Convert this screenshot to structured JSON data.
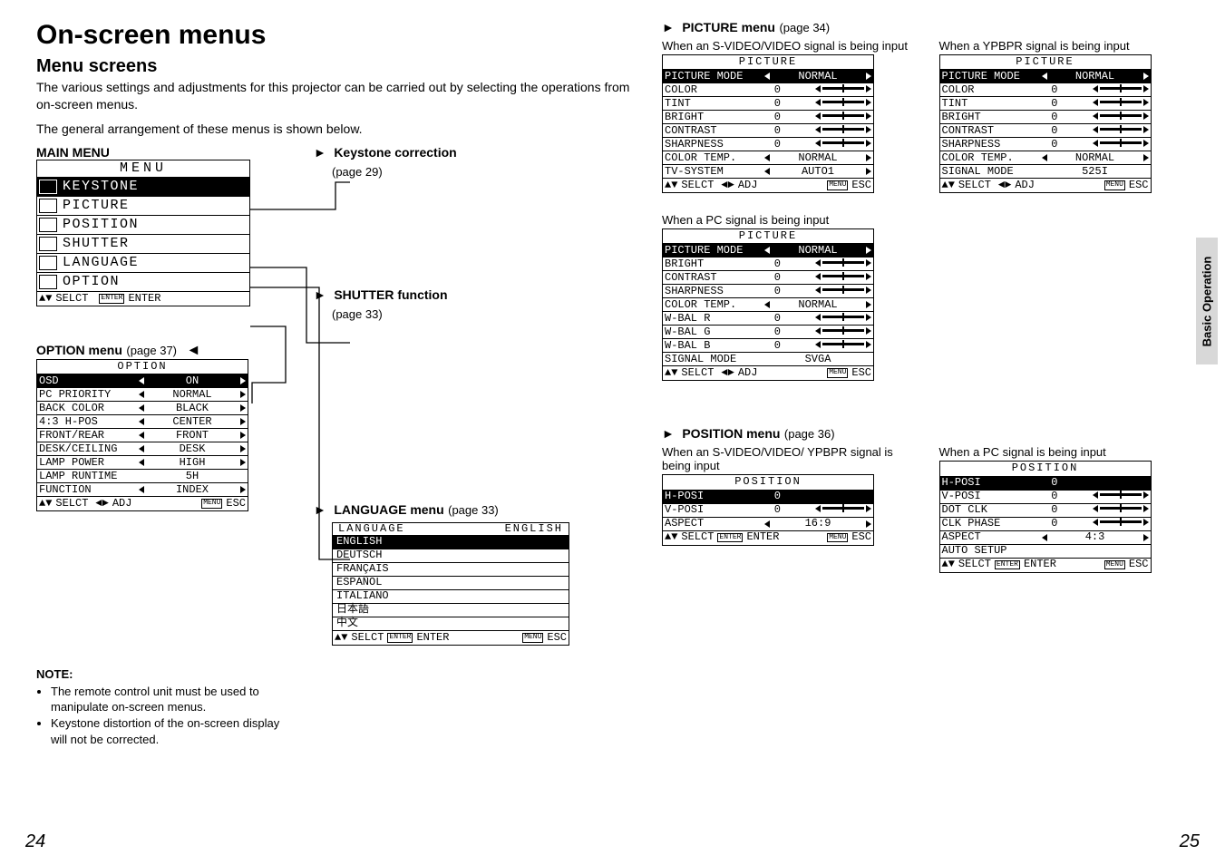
{
  "header": {
    "title": "On-screen menus",
    "subtitle": "Menu screens",
    "intro1": "The various settings and adjustments for this projector can be carried out by selecting the operations from on-screen menus.",
    "intro2": "The general arrangement of these menus is shown below."
  },
  "labels": {
    "main_menu": "MAIN MENU",
    "keystone": "Keystone correction",
    "keystone_ref": "(page 29)",
    "shutter": "SHUTTER function",
    "shutter_ref": "(page 33)",
    "option": "OPTION menu",
    "option_ref": "(page 37)",
    "language": "LANGUAGE menu",
    "language_ref": "(page 33)",
    "picture": "PICTURE menu",
    "picture_ref": "(page 34)",
    "picture_cap_sv": "When an S-VIDEO/VIDEO signal is being input",
    "picture_cap_yp": "When a YPBPR signal is being input",
    "picture_cap_pc": "When a PC signal is being input",
    "position": "POSITION menu",
    "position_ref": "(page 36)",
    "position_cap_sv": "When an S-VIDEO/VIDEO/ YPBPR signal is being input",
    "position_cap_pc": "When a PC signal is being input",
    "side_tab": "Basic Operation",
    "note_hdr": "NOTE:",
    "note1": "The remote control unit must be used to manipulate on-screen menus.",
    "note2": "Keystone distortion of the on-screen display will not be corrected.",
    "page_left": "24",
    "page_right": "25"
  },
  "main_menu": {
    "title": "MENU",
    "items": [
      "KEYSTONE",
      "PICTURE",
      "POSITION",
      "SHUTTER",
      "LANGUAGE",
      "OPTION"
    ],
    "footer_selct": "SELCT",
    "footer_enter_box": "ENTER",
    "footer_enter": "ENTER"
  },
  "option_menu": {
    "title": "OPTION",
    "rows": [
      {
        "k": "OSD",
        "v": "ON",
        "sel": true
      },
      {
        "k": "PC PRIORITY",
        "v": "NORMAL"
      },
      {
        "k": "BACK COLOR",
        "v": "BLACK"
      },
      {
        "k": "4:3 H-POS",
        "v": "CENTER"
      },
      {
        "k": "FRONT/REAR",
        "v": "FRONT"
      },
      {
        "k": "DESK/CEILING",
        "v": "DESK"
      },
      {
        "k": "LAMP POWER",
        "v": "HIGH"
      },
      {
        "k": "LAMP RUNTIME",
        "v": "5H",
        "plain": true
      },
      {
        "k": "FUNCTION",
        "v": "INDEX"
      }
    ],
    "footer_l": "SELCT",
    "footer_m": "ADJ",
    "footer_box": "MENU",
    "footer_r": "ESC"
  },
  "language_menu": {
    "title": "LANGUAGE",
    "current": "ENGLISH",
    "items": [
      "ENGLISH",
      "DEUTSCH",
      "FRANÇAIS",
      "ESPAÑOL",
      "ITALIANO",
      "日本語",
      "中文"
    ],
    "footer_l": "SELCT",
    "footer_boxA": "ENTER",
    "footer_m": "ENTER",
    "footer_boxB": "MENU",
    "footer_r": "ESC"
  },
  "picture_sv": {
    "title": "PICTURE",
    "rows": [
      {
        "k": "PICTURE MODE",
        "v": "NORMAL",
        "sel": true,
        "chev": true
      },
      {
        "k": "COLOR",
        "v": "0",
        "slider": true
      },
      {
        "k": "TINT",
        "v": "0",
        "slider": true
      },
      {
        "k": "BRIGHT",
        "v": "0",
        "slider": true
      },
      {
        "k": "CONTRAST",
        "v": "0",
        "slider": true
      },
      {
        "k": "SHARPNESS",
        "v": "0",
        "slider": true
      },
      {
        "k": "COLOR TEMP.",
        "v": "NORMAL",
        "chev": true
      },
      {
        "k": "TV-SYSTEM",
        "v": "AUTO1",
        "chev": true
      }
    ],
    "footer_l": "SELCT",
    "footer_m": "ADJ",
    "footer_box": "MENU",
    "footer_r": "ESC"
  },
  "picture_yp": {
    "title": "PICTURE",
    "rows": [
      {
        "k": "PICTURE MODE",
        "v": "NORMAL",
        "sel": true,
        "chev": true
      },
      {
        "k": "COLOR",
        "v": "0",
        "slider": true
      },
      {
        "k": "TINT",
        "v": "0",
        "slider": true
      },
      {
        "k": "BRIGHT",
        "v": "0",
        "slider": true
      },
      {
        "k": "CONTRAST",
        "v": "0",
        "slider": true
      },
      {
        "k": "SHARPNESS",
        "v": "0",
        "slider": true
      },
      {
        "k": "COLOR TEMP.",
        "v": "NORMAL",
        "chev": true
      },
      {
        "k": "SIGNAL MODE",
        "v": "525I",
        "plain": true
      }
    ],
    "footer_l": "SELCT",
    "footer_m": "ADJ",
    "footer_box": "MENU",
    "footer_r": "ESC"
  },
  "picture_pc": {
    "title": "PICTURE",
    "rows": [
      {
        "k": "PICTURE MODE",
        "v": "NORMAL",
        "sel": true,
        "chev": true
      },
      {
        "k": "BRIGHT",
        "v": "0",
        "slider": true
      },
      {
        "k": "CONTRAST",
        "v": "0",
        "slider": true
      },
      {
        "k": "SHARPNESS",
        "v": "0",
        "slider": true
      },
      {
        "k": "COLOR TEMP.",
        "v": "NORMAL",
        "chev": true
      },
      {
        "k": "W-BAL R",
        "v": "0",
        "slider": true
      },
      {
        "k": "W-BAL G",
        "v": "0",
        "slider": true
      },
      {
        "k": "W-BAL B",
        "v": "0",
        "slider": true
      },
      {
        "k": "SIGNAL MODE",
        "v": "SVGA",
        "plain": true
      }
    ],
    "footer_l": "SELCT",
    "footer_m": "ADJ",
    "footer_box": "MENU",
    "footer_r": "ESC"
  },
  "position_sv": {
    "title": "POSITION",
    "rows": [
      {
        "k": "H-POSI",
        "v": "0",
        "sel": true,
        "slider": true
      },
      {
        "k": "V-POSI",
        "v": "0",
        "slider": true
      },
      {
        "k": "ASPECT",
        "v": "16:9",
        "chev": true
      }
    ],
    "footer_l": "SELCT",
    "footer_boxA": "ENTER",
    "footer_m": "ENTER",
    "footer_boxB": "MENU",
    "footer_r": "ESC"
  },
  "position_pc": {
    "title": "POSITION",
    "rows": [
      {
        "k": "H-POSI",
        "v": "0",
        "sel": true,
        "slider": true
      },
      {
        "k": "V-POSI",
        "v": "0",
        "slider": true
      },
      {
        "k": "DOT CLK",
        "v": "0",
        "slider": true
      },
      {
        "k": "CLK PHASE",
        "v": "0",
        "slider": true
      },
      {
        "k": "ASPECT",
        "v": "4:3",
        "chev": true
      },
      {
        "k": "AUTO SETUP",
        "v": "",
        "plain": true
      }
    ],
    "footer_l": "SELCT",
    "footer_boxA": "ENTER",
    "footer_m": "ENTER",
    "footer_boxB": "MENU",
    "footer_r": "ESC"
  }
}
